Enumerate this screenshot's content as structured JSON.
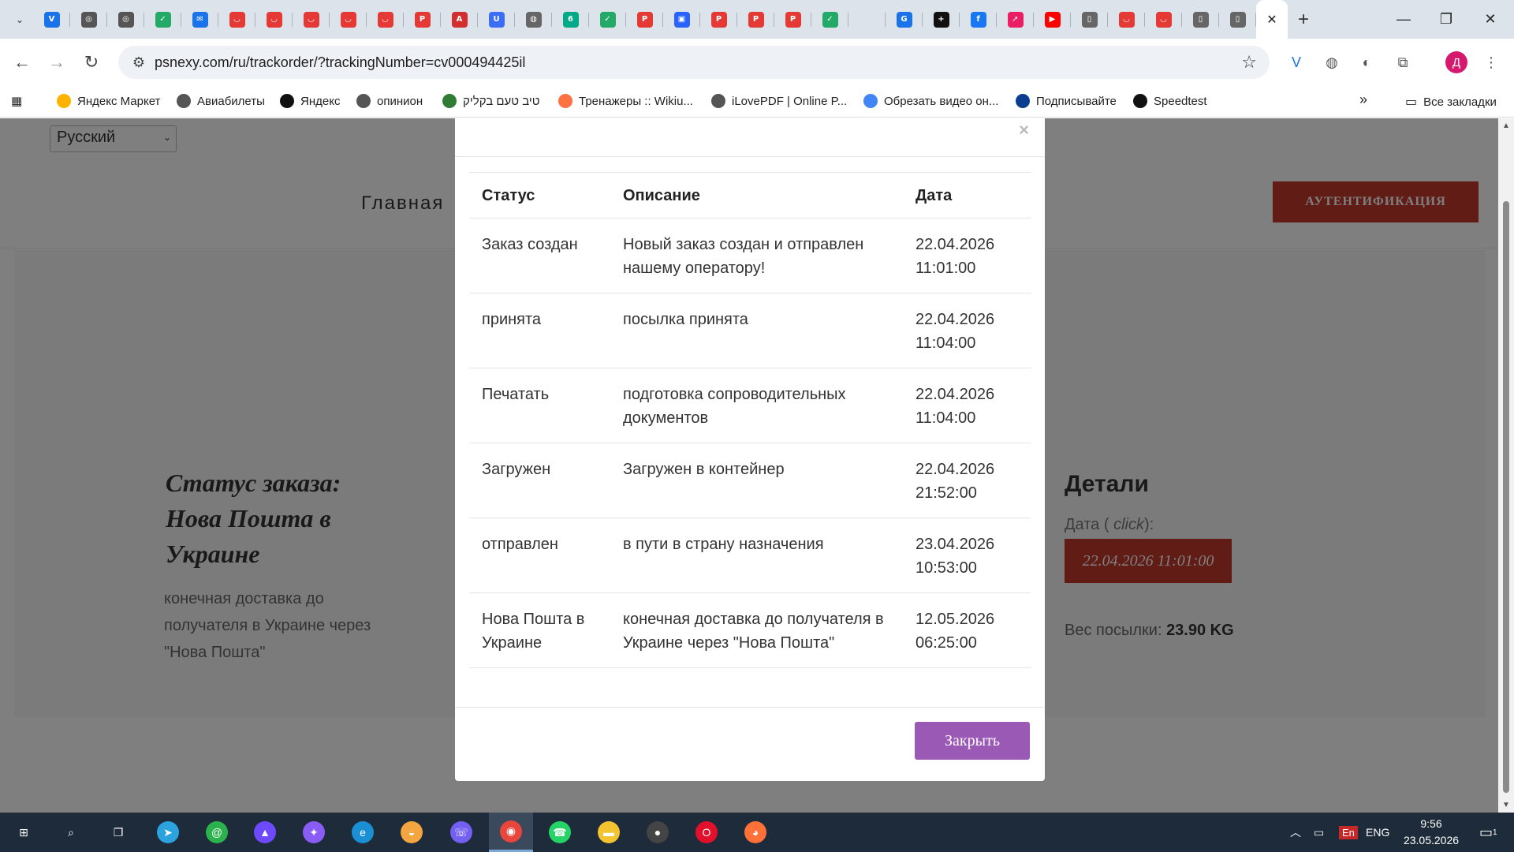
{
  "browser": {
    "tabs": [
      {
        "icon": "vee-icon",
        "color": "#1a73e8",
        "glyph": "V"
      },
      {
        "icon": "chrome-icon",
        "color": "#555",
        "glyph": "◎"
      },
      {
        "icon": "chrome-icon",
        "color": "#555",
        "glyph": "◎"
      },
      {
        "icon": "check-icon",
        "color": "#2a6",
        "glyph": "✓"
      },
      {
        "icon": "mail-icon",
        "color": "#1a73e8",
        "glyph": "✉"
      },
      {
        "icon": "shop-icon",
        "color": "#e53935",
        "glyph": "◡"
      },
      {
        "icon": "shop-icon",
        "color": "#e53935",
        "glyph": "◡"
      },
      {
        "icon": "shop-icon",
        "color": "#e53935",
        "glyph": "◡"
      },
      {
        "icon": "shop-icon",
        "color": "#e53935",
        "glyph": "◡"
      },
      {
        "icon": "shop-icon",
        "color": "#e53935",
        "glyph": "◡"
      },
      {
        "icon": "pdf-icon",
        "color": "#e53935",
        "glyph": "P"
      },
      {
        "icon": "acrobat-icon",
        "color": "#d32f2f",
        "glyph": "A"
      },
      {
        "icon": "u-icon",
        "color": "#3b6ef5",
        "glyph": "U"
      },
      {
        "icon": "globe-icon",
        "color": "#666",
        "glyph": "◍"
      },
      {
        "icon": "six-icon",
        "color": "#0a8",
        "glyph": "6"
      },
      {
        "icon": "check-icon",
        "color": "#2a6",
        "glyph": "✓"
      },
      {
        "icon": "pdf-icon",
        "color": "#e53935",
        "glyph": "P"
      },
      {
        "icon": "image-icon",
        "color": "#2962ff",
        "glyph": "▣"
      },
      {
        "icon": "pdf-icon",
        "color": "#e53935",
        "glyph": "P"
      },
      {
        "icon": "pdf-icon",
        "color": "#e53935",
        "glyph": "P"
      },
      {
        "icon": "pdf-icon",
        "color": "#e53935",
        "glyph": "P"
      },
      {
        "icon": "check-icon",
        "color": "#2a6",
        "glyph": "✓"
      },
      {
        "icon": "blank-icon",
        "color": "#dde3ea",
        "glyph": ""
      },
      {
        "icon": "translate-icon",
        "color": "#1a73e8",
        "glyph": "G"
      },
      {
        "icon": "plus-square-icon",
        "color": "#111",
        "glyph": "+"
      },
      {
        "icon": "facebook-icon",
        "color": "#1877f2",
        "glyph": "f"
      },
      {
        "icon": "arrow-app-icon",
        "color": "#e91e63",
        "glyph": "➚"
      },
      {
        "icon": "youtube-icon",
        "color": "#ff0000",
        "glyph": "▶"
      },
      {
        "icon": "doc-icon",
        "color": "#666",
        "glyph": "▯"
      },
      {
        "icon": "shop-icon",
        "color": "#e53935",
        "glyph": "◡"
      },
      {
        "icon": "shop-icon",
        "color": "#e53935",
        "glyph": "◡"
      },
      {
        "icon": "doc-icon",
        "color": "#666",
        "glyph": "▯"
      },
      {
        "icon": "doc-icon",
        "color": "#666",
        "glyph": "▯"
      }
    ],
    "active_tab_close": "✕",
    "new_tab": "+",
    "url": "psnexy.com/ru/trackorder/?trackingNumber=cv000494425il",
    "profile_initial": "Д",
    "bookmarks": [
      {
        "label": "Яндекс Маркет",
        "icon": "yandex-market-icon",
        "color": "#ffb300"
      },
      {
        "label": "Авиабилеты",
        "icon": "globe-icon",
        "color": "#555"
      },
      {
        "label": "Яндекс",
        "icon": "yandex-icon",
        "color": "#111"
      },
      {
        "label": "опинион",
        "icon": "globe-icon",
        "color": "#555"
      },
      {
        "label": "טיב טעם בקליק",
        "icon": "leaf-icon",
        "color": "#2e7d32"
      },
      {
        "label": "Тренажеры :: Wikiu...",
        "icon": "fan-icon",
        "color": "#ff7043"
      },
      {
        "label": "iLovePDF | Online P...",
        "icon": "globe-icon",
        "color": "#555"
      },
      {
        "label": "Обрезать видео он...",
        "icon": "dots-icon",
        "color": "#4285f4"
      },
      {
        "label": "Подписывайте",
        "icon": "sign-icon",
        "color": "#0b3d91"
      },
      {
        "label": "Speedtest",
        "icon": "speedtest-icon",
        "color": "#111"
      }
    ],
    "bookmarks_overflow": "»",
    "all_bookmarks": "Все закладки"
  },
  "page": {
    "language": "Русский",
    "nav_home": "Главная",
    "auth_button": "АУТЕНТИФИКАЦИЯ",
    "status_title": "Статус заказа: Нова Пошта в Украине",
    "status_description": "конечная доставка до получателя в Украине через \"Нова Пошта\"",
    "details_title": "Детали",
    "date_label_prefix": "Дата ( ",
    "date_label_click": "click",
    "date_label_suffix": "):",
    "date_value": "22.04.2026 11:01:00",
    "weight_label": "Вес посылки: ",
    "weight_value": "23.90 KG"
  },
  "modal": {
    "close_x": "×",
    "headers": {
      "status": "Статус",
      "description": "Описание",
      "date": "Дата"
    },
    "rows": [
      {
        "status": "Заказ создан",
        "description": "Новый заказ создан и отправлен нашему оператору!",
        "date": "22.04.2026 11:01:00"
      },
      {
        "status": "принята",
        "description": "посылка принята",
        "date": "22.04.2026 11:04:00"
      },
      {
        "status": "Печатать",
        "description": "подготовка сопроводительных документов",
        "date": "22.04.2026 11:04:00"
      },
      {
        "status": "Загружен",
        "description": "Загружен в контейнер",
        "date": "22.04.2026 21:52:00"
      },
      {
        "status": "отправлен",
        "description": "в пути в страну назначения",
        "date": "23.04.2026 10:53:00"
      },
      {
        "status": "Нова Пошта в Украине",
        "description": "конечная доставка до получателя в Украине через \"Нова Пошта\"",
        "date": "12.05.2026 06:25:00"
      }
    ],
    "close_button": "Закрыть"
  },
  "taskbar": {
    "apps": [
      {
        "name": "start-icon",
        "color": "#1e2b3a",
        "glyph": "⊞"
      },
      {
        "name": "search-icon",
        "color": "#1e2b3a",
        "glyph": "⌕"
      },
      {
        "name": "task-view-icon",
        "color": "#1e2b3a",
        "glyph": "❐"
      },
      {
        "name": "telegram-icon",
        "color": "#2aa3de",
        "glyph": "➤"
      },
      {
        "name": "at-mail-icon",
        "color": "#2bb24c",
        "glyph": "@"
      },
      {
        "name": "proton-icon",
        "color": "#6d4aff",
        "glyph": "▲"
      },
      {
        "name": "copilot-icon",
        "color": "#8a5cf6",
        "glyph": "✦"
      },
      {
        "name": "edge-icon",
        "color": "#1b8fd3",
        "glyph": "e"
      },
      {
        "name": "photos-icon",
        "color": "#f3a640",
        "glyph": "◒"
      },
      {
        "name": "viber-icon",
        "color": "#7360f2",
        "glyph": "☏"
      },
      {
        "name": "chrome-icon",
        "color": "#e8453c",
        "glyph": "◉"
      },
      {
        "name": "whatsapp-icon",
        "color": "#25d366",
        "glyph": "☎"
      },
      {
        "name": "explorer-icon",
        "color": "#f4c430",
        "glyph": "▬"
      },
      {
        "name": "record-icon",
        "color": "#444",
        "glyph": "●"
      },
      {
        "name": "opera-icon",
        "color": "#e3102b",
        "glyph": "O"
      },
      {
        "name": "firefox-icon",
        "color": "#ff7139",
        "glyph": "◕"
      }
    ],
    "input_lang_short": "En",
    "input_lang": "ENG",
    "time": "9:56",
    "date": "23.05.2026",
    "notifications": "1"
  }
}
